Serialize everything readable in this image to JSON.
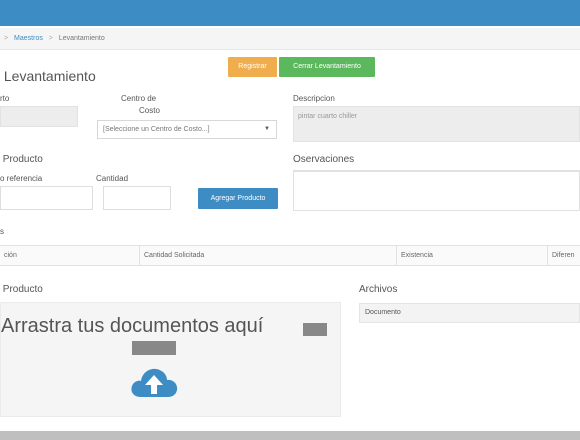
{
  "breadcrumb": {
    "link": "Maestros",
    "current": "Levantamiento"
  },
  "page": {
    "title": "Levantamiento"
  },
  "toolbar": {
    "register_label": "Registrar",
    "close_label": "Cerrar Levantamiento"
  },
  "form": {
    "col1_label": "rto",
    "cost_center_label_line1": "Centro de",
    "cost_center_label_line2": "Costo",
    "cost_center_placeholder": "[Seleccione un Centro de Costo...]",
    "description_label": "Descripcion",
    "description_value": "pintar cuarto chiller"
  },
  "product_section": {
    "title": "Producto",
    "reference_label": "o referencia",
    "quantity_label": "Cantidad",
    "add_button": "Agregar Producto"
  },
  "observations": {
    "title": "Oservaciones"
  },
  "table": {
    "section_label": "s",
    "headers": [
      "ción",
      "Cantidad Solicitada",
      "Existencia",
      "Diferen"
    ]
  },
  "upload": {
    "section_title": "Producto",
    "dropzone_text": "Arrastra tus documentos aquí"
  },
  "archives": {
    "title": "Archivos",
    "column": "Documento"
  },
  "colors": {
    "topbar": "#3d8dc4",
    "register": "#f0ad4e",
    "close": "#5cb85c",
    "add": "#3d8dc4"
  }
}
